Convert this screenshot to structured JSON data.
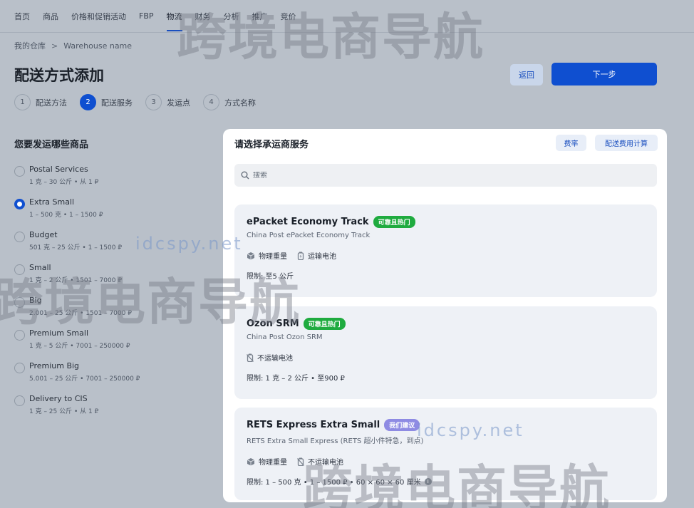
{
  "nav": {
    "items": [
      "首页",
      "商品",
      "价格和促销活动",
      "FBP",
      "物流",
      "财务",
      "分析",
      "推广",
      "竞价"
    ],
    "active": "物流"
  },
  "breadcrumb": {
    "root": "我的仓库",
    "separator": ">",
    "current": "Warehouse name"
  },
  "page": {
    "title": "配送方式添加",
    "back_label": "返回",
    "next_label": "下一步"
  },
  "steps": [
    {
      "num": "1",
      "label": "配送方法"
    },
    {
      "num": "2",
      "label": "配送服务"
    },
    {
      "num": "3",
      "label": "发运点"
    },
    {
      "num": "4",
      "label": "方式名称"
    }
  ],
  "active_step": 2,
  "left": {
    "title": "您要发运哪些商品",
    "tariffs": [
      {
        "name": "Postal Services",
        "desc": "1 克 – 30 公斤 • 从 1 ₽"
      },
      {
        "name": "Extra Small",
        "desc": "1 – 500 克 • 1 – 1500 ₽"
      },
      {
        "name": "Budget",
        "desc": "501 克 – 25 公斤 • 1 – 1500 ₽"
      },
      {
        "name": "Small",
        "desc": "1 克 – 2 公斤 • 1501 – 7000 ₽"
      },
      {
        "name": "Big",
        "desc": "2.001 – 25 公斤 • 1501 – 7000 ₽"
      },
      {
        "name": "Premium Small",
        "desc": "1 克 – 5 公斤 • 7001 – 250000 ₽"
      },
      {
        "name": "Premium Big",
        "desc": "5.001 – 25 公斤 • 7001 – 250000 ₽"
      },
      {
        "name": "Delivery to CIS",
        "desc": "1 克 – 25 公斤 • 从 1 ₽"
      }
    ],
    "selected_index": 1
  },
  "panel": {
    "title": "请选择承运商服务",
    "rates_label": "费率",
    "calc_label": "配送费用计算",
    "search_placeholder": "搜索",
    "cards": [
      {
        "name": "ePacket Economy Track",
        "badge": "可靠且热门",
        "sub": "China Post ePacket Economy Track",
        "features": [
          "物理重量",
          "运输电池"
        ],
        "feature_icons": [
          "weight-icon",
          "battery-icon"
        ],
        "limit": "限制: 至5 公斤"
      },
      {
        "name": "Ozon SRM",
        "badge": "可靠且热门",
        "sub": "China Post Ozon SRM",
        "features": [
          "不运输电池"
        ],
        "feature_icons": [
          "no-battery-icon"
        ],
        "limit": "限制: 1 克 – 2 公斤 • 至900 ₽"
      },
      {
        "name": "RETS Express Extra Small",
        "badge": "我们建议",
        "sub": "RETS Extra Small Express (RETS 超小件特急，到点)",
        "features": [
          "物理重量",
          "不运输电池"
        ],
        "feature_icons": [
          "weight-icon",
          "no-battery-icon"
        ],
        "limit": "限制: 1 – 500 克 • 1 – 1500 ₽ • 60 × 60 × 60 厘米"
      }
    ]
  },
  "watermark": {
    "cn": "跨境电商导航",
    "url": "idcspy.net"
  },
  "colors": {
    "primary": "#0f4fd0",
    "badge_green": "#1fab3f",
    "badge_purple": "#8e8be3"
  }
}
